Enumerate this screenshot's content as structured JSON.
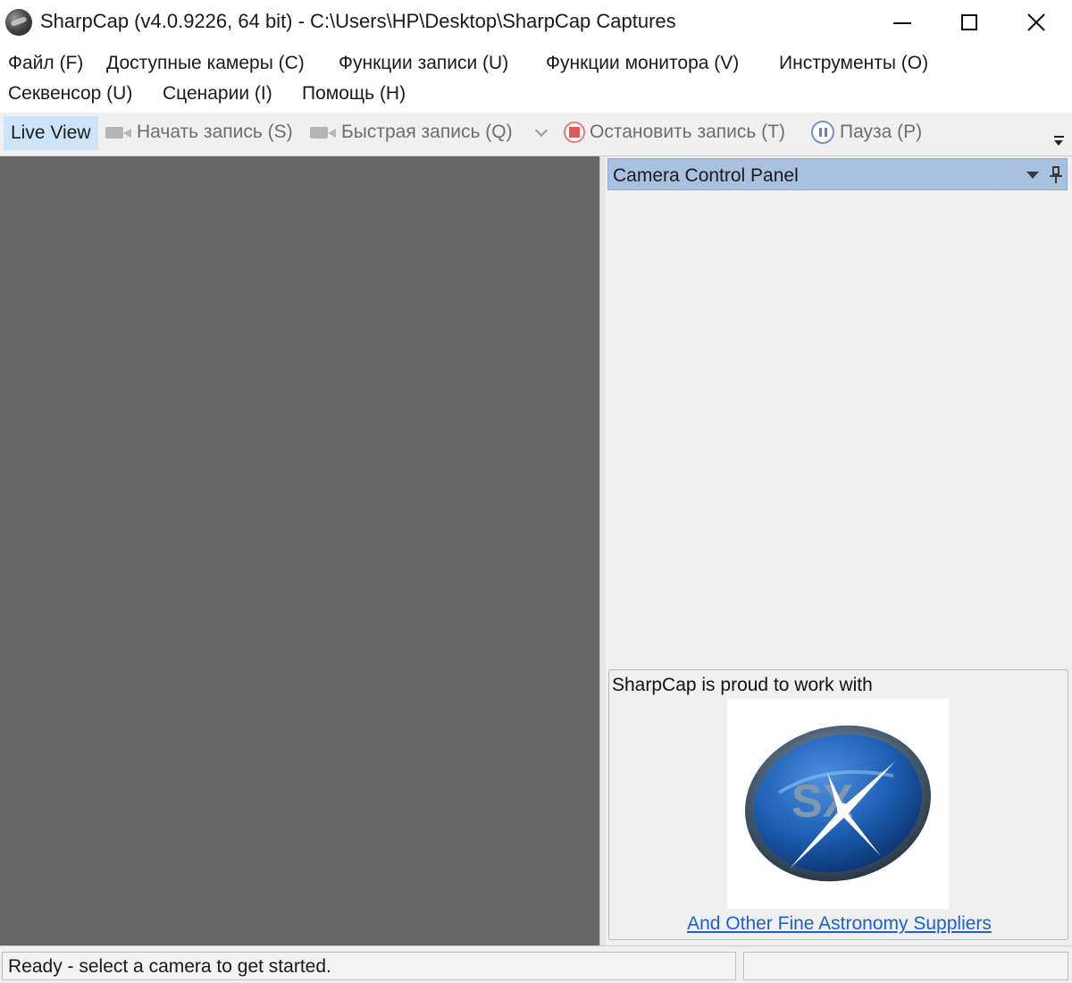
{
  "window": {
    "title": "SharpCap (v4.0.9226, 64 bit) - C:\\Users\\HP\\Desktop\\SharpCap Captures",
    "app_icon": "sharpcap-logo-icon"
  },
  "menu": {
    "items": [
      {
        "label": "Файл (F)"
      },
      {
        "label": "Доступные камеры (C)"
      },
      {
        "label": "Функции записи (U)"
      },
      {
        "label": "Функции монитора (V)"
      },
      {
        "label": "Инструменты (O)"
      },
      {
        "label": "Секвенсор (U)"
      },
      {
        "label": "Сценарии (I)"
      },
      {
        "label": "Помощь (H)"
      }
    ]
  },
  "toolbar": {
    "live_view": "Live View",
    "start_capture": "Начать запись (S)",
    "quick_capture": "Быстрая запись (Q)",
    "stop_capture": "Остановить запись (T)",
    "pause": "Пауза (P)"
  },
  "panel": {
    "title": "Camera Control Panel"
  },
  "sponsor": {
    "text": "SharpCap is proud to work with",
    "logo_letters": "SX",
    "link": "And Other Fine Astronomy Suppliers"
  },
  "status": {
    "text": "Ready - select a camera to get started."
  },
  "colors": {
    "viewer_bg": "#666666",
    "panel_header": "#a8c1df",
    "live_view_highlight": "#cce4f7",
    "link": "#1b5fd1"
  }
}
